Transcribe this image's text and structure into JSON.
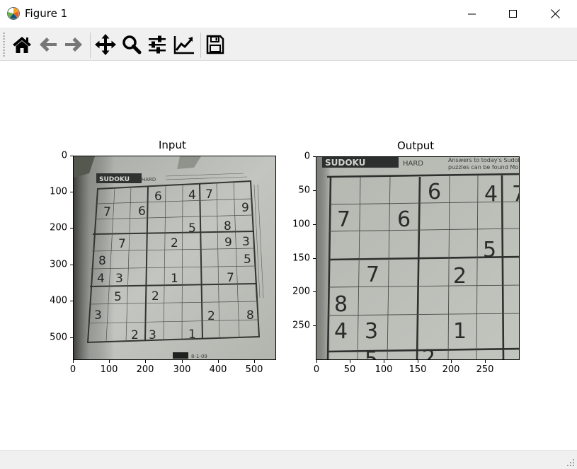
{
  "window": {
    "title": "Figure 1",
    "controls": [
      "minimize",
      "maximize",
      "close"
    ]
  },
  "toolbar": {
    "buttons": [
      {
        "name": "home",
        "icon": "home-icon"
      },
      {
        "name": "back",
        "icon": "arrow-left-icon"
      },
      {
        "name": "forward",
        "icon": "arrow-right-icon"
      },
      {
        "name": "pan",
        "icon": "move-arrows-icon"
      },
      {
        "name": "zoom",
        "icon": "magnifier-icon"
      },
      {
        "name": "configure-subplots",
        "icon": "sliders-icon"
      },
      {
        "name": "edit-axes",
        "icon": "chart-line-icon"
      },
      {
        "name": "save",
        "icon": "floppy-disk-icon"
      }
    ]
  },
  "figure": {
    "input_panel": {
      "title": "Input",
      "image_description": "photo of sudoku puzzle page",
      "xlim": [
        0,
        560
      ],
      "ylim": [
        560,
        0
      ],
      "xticks": [
        "0",
        "100",
        "200",
        "300",
        "400",
        "500"
      ],
      "yticks": [
        "0",
        "100",
        "200",
        "300",
        "400",
        "500"
      ]
    },
    "output_panel": {
      "title": "Output",
      "image_description": "perspective-corrected sudoku crop",
      "xlim": [
        0,
        300
      ],
      "ylim": [
        300,
        0
      ],
      "xticks": [
        "0",
        "50",
        "100",
        "150",
        "200",
        "250"
      ],
      "yticks": [
        "0",
        "50",
        "100",
        "150",
        "200",
        "250"
      ]
    }
  },
  "colors": {
    "paper": "#b9bdb6",
    "ink": "#2a2c2a",
    "header": "#2b2e2c",
    "chrome": "#f0f0f0"
  }
}
